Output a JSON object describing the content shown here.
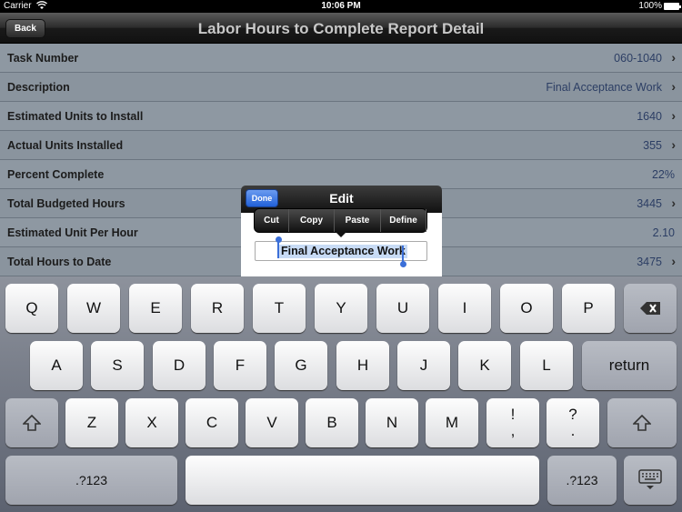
{
  "status_bar": {
    "carrier": "Carrier",
    "time": "10:06 PM",
    "battery": "100%"
  },
  "nav": {
    "back_label": "Back",
    "title": "Labor Hours to Complete Report Detail"
  },
  "rows": [
    {
      "label": "Task Number",
      "value": "060-1040",
      "chevron": true
    },
    {
      "label": "Description",
      "value": "Final Acceptance Work",
      "chevron": true
    },
    {
      "label": "Estimated Units to Install",
      "value": "1640",
      "chevron": true
    },
    {
      "label": "Actual Units Installed",
      "value": "355",
      "chevron": true
    },
    {
      "label": "Percent Complete",
      "value": "22%",
      "chevron": false
    },
    {
      "label": "Total Budgeted Hours",
      "value": "3445",
      "chevron": true
    },
    {
      "label": "Estimated Unit Per Hour",
      "value": "2.10",
      "chevron": false
    },
    {
      "label": "Total Hours to Date",
      "value": "3475",
      "chevron": true
    }
  ],
  "popover": {
    "done_label": "Done",
    "title": "Edit",
    "field_value": "Final Acceptance Work",
    "menu": [
      "Cut",
      "Copy",
      "Paste",
      "Define"
    ]
  },
  "keyboard": {
    "row1": [
      "Q",
      "W",
      "E",
      "R",
      "T",
      "Y",
      "U",
      "I",
      "O",
      "P"
    ],
    "row2": [
      "A",
      "S",
      "D",
      "F",
      "G",
      "H",
      "J",
      "K",
      "L"
    ],
    "return_label": "return",
    "row3": [
      "Z",
      "X",
      "C",
      "V",
      "B",
      "N",
      "M"
    ],
    "punct1": [
      "!",
      ","
    ],
    "punct2": [
      "?",
      "."
    ],
    "numbers_label": ".?123"
  }
}
